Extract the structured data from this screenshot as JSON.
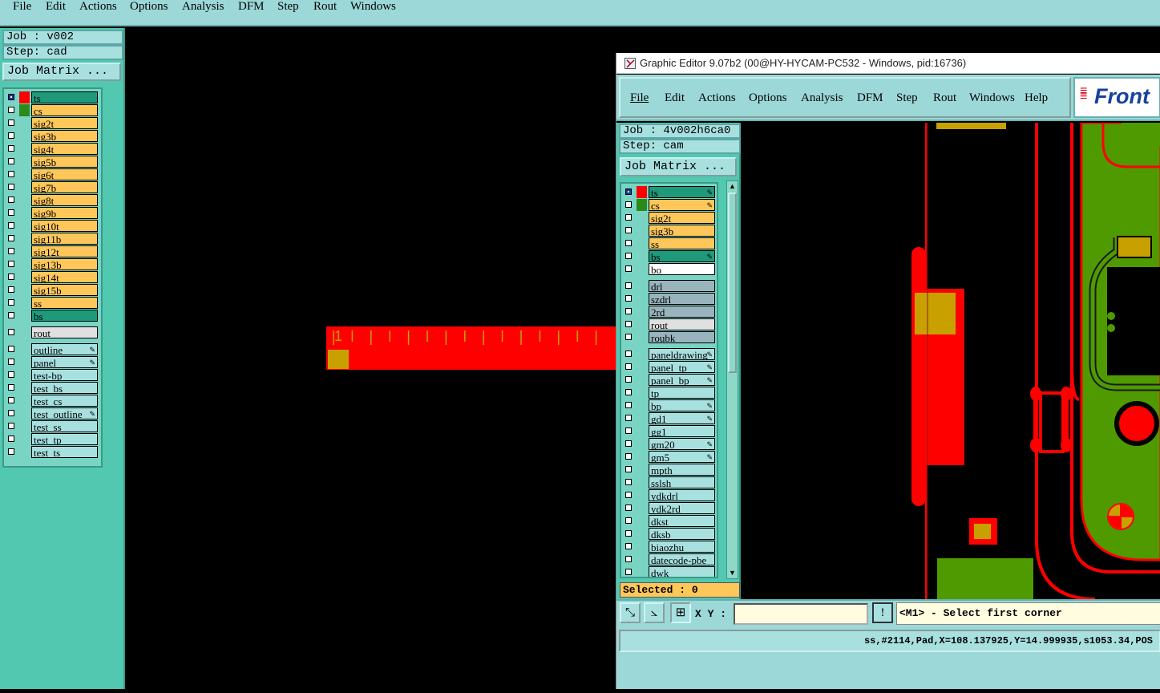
{
  "main": {
    "menu": [
      "File",
      "Edit",
      "Actions",
      "Options",
      "Analysis",
      "DFM",
      "Step",
      "Rout",
      "Windows"
    ],
    "job": "Job : v002",
    "step": "Step: cad",
    "job_matrix": "Job Matrix ...",
    "layers": [
      {
        "name": "ts",
        "color": "#1e9a7a"
      },
      {
        "name": "cs",
        "color": "#ffc65a"
      },
      {
        "name": "sig2t",
        "color": "#ffc65a"
      },
      {
        "name": "sig3b",
        "color": "#ffc65a"
      },
      {
        "name": "sig4t",
        "color": "#ffc65a"
      },
      {
        "name": "sig5b",
        "color": "#ffc65a"
      },
      {
        "name": "sig6t",
        "color": "#ffc65a"
      },
      {
        "name": "sig7b",
        "color": "#ffc65a"
      },
      {
        "name": "sig8t",
        "color": "#ffc65a"
      },
      {
        "name": "sig9b",
        "color": "#ffc65a"
      },
      {
        "name": "sig10t",
        "color": "#ffc65a"
      },
      {
        "name": "sig11b",
        "color": "#ffc65a"
      },
      {
        "name": "sig12t",
        "color": "#ffc65a"
      },
      {
        "name": "sig13b",
        "color": "#ffc65a"
      },
      {
        "name": "sig14t",
        "color": "#ffc65a"
      },
      {
        "name": "sig15b",
        "color": "#ffc65a"
      },
      {
        "name": "ss",
        "color": "#ffc65a"
      },
      {
        "name": "bs",
        "color": "#1e9a7a"
      }
    ],
    "rout_layers": [
      {
        "name": "rout",
        "color": "#e0e0e0"
      }
    ],
    "misc_layers": [
      {
        "name": "outline",
        "color": "#a8e0e0"
      },
      {
        "name": "panel",
        "color": "#a8e0e0"
      },
      {
        "name": "test-bp",
        "color": "#a8e0e0"
      },
      {
        "name": "test_bs",
        "color": "#a8e0e0"
      },
      {
        "name": "test_cs",
        "color": "#a8e0e0"
      },
      {
        "name": "test_outline",
        "color": "#a8e0e0"
      },
      {
        "name": "test_ss",
        "color": "#a8e0e0"
      },
      {
        "name": "test_tp",
        "color": "#a8e0e0"
      },
      {
        "name": "test_ts",
        "color": "#a8e0e0"
      }
    ],
    "ruler_label": "1"
  },
  "editor": {
    "title": "Graphic Editor 9.07b2 (00@HY-HYCAM-PC532 - Windows, pid:16736)",
    "menu": [
      "File",
      "Edit",
      "Actions",
      "Options",
      "Analysis",
      "DFM",
      "Step",
      "Rout",
      "Windows"
    ],
    "help": "Help",
    "logo": "Front",
    "job": "Job : 4v002h6ca0",
    "step": "Step: cam",
    "job_matrix": "Job Matrix ...",
    "board_layers": [
      {
        "name": "ts",
        "color": "#1e9a7a"
      },
      {
        "name": "cs",
        "color": "#ffc65a"
      },
      {
        "name": "sig2t",
        "color": "#ffc65a"
      },
      {
        "name": "sig3b",
        "color": "#ffc65a"
      },
      {
        "name": "ss",
        "color": "#ffc65a"
      },
      {
        "name": "bs",
        "color": "#1e9a7a"
      },
      {
        "name": "bo",
        "color": "#ffffff"
      }
    ],
    "drill_layers": [
      {
        "name": "drl",
        "color": "#9ab4be"
      },
      {
        "name": "szdrl",
        "color": "#9ab4be"
      },
      {
        "name": "2rd",
        "color": "#9ab4be"
      },
      {
        "name": "rout",
        "color": "#e0e0e0"
      },
      {
        "name": "roubk",
        "color": "#9ab4be"
      }
    ],
    "misc_layers": [
      {
        "name": "paneldrawing",
        "color": "#a8e0e0"
      },
      {
        "name": "panel_tp",
        "color": "#a8e0e0"
      },
      {
        "name": "panel_bp",
        "color": "#a8e0e0"
      },
      {
        "name": "tp",
        "color": "#a8e0e0"
      },
      {
        "name": "bp",
        "color": "#a8e0e0"
      },
      {
        "name": "gd1",
        "color": "#a8e0e0"
      },
      {
        "name": "gg1",
        "color": "#a8e0e0"
      },
      {
        "name": "gm20",
        "color": "#a8e0e0"
      },
      {
        "name": "gm5",
        "color": "#a8e0e0"
      },
      {
        "name": "mpth",
        "color": "#a8e0e0"
      },
      {
        "name": "sslsh",
        "color": "#a8e0e0"
      },
      {
        "name": "ydkdrl",
        "color": "#a8e0e0"
      },
      {
        "name": "ydk2rd",
        "color": "#a8e0e0"
      },
      {
        "name": "dkst",
        "color": "#a8e0e0"
      },
      {
        "name": "dksb",
        "color": "#a8e0e0"
      },
      {
        "name": "biaozhu",
        "color": "#a8e0e0"
      },
      {
        "name": "datecode-pbe",
        "color": "#a8e0e0"
      },
      {
        "name": "dwk",
        "color": "#a8e0e0"
      }
    ],
    "selected": "Selected : 0",
    "xy_label": "X Y :",
    "xy_value": "",
    "prompt": "<M1> - Select first corner",
    "status": "ss,#2114,Pad,X=108.137925,Y=14.999935,s1053.34,POS"
  },
  "colors": {
    "teal": "#1e9a7a",
    "orange": "#ffc65a",
    "panel": "#a8e0e0",
    "red": "#ff0000",
    "green": "#4f9a00",
    "gold": "#c8a000"
  }
}
